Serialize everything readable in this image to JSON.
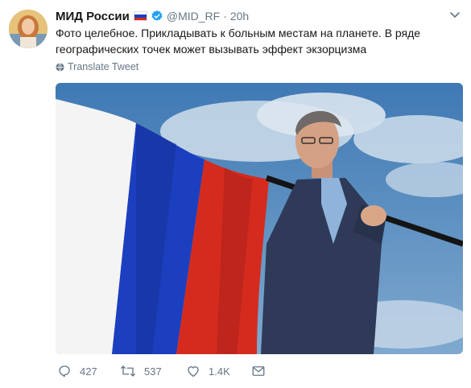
{
  "user": {
    "name": "МИД России",
    "handle": "@MID_RF",
    "separator": "·",
    "time": "20h"
  },
  "tweet": {
    "text": "Фото целебное. Прикладывать к больным местам на планете. В ряде географических точек может вызывать эффект экзорцизма",
    "translate_label": "Translate Tweet"
  },
  "stats": {
    "replies": "427",
    "retweets": "537",
    "likes": "1.4K"
  },
  "colors": {
    "verified": "#1da1f2",
    "secondary_text": "#657786",
    "flag_white": "#ffffff",
    "flag_blue": "#1c3fbf",
    "flag_red": "#d52b1e"
  },
  "icons": [
    "flag-russia-icon",
    "verified-badge-icon",
    "chevron-down-icon",
    "globe-icon",
    "reply-icon",
    "retweet-icon",
    "like-icon",
    "direct-message-icon"
  ]
}
